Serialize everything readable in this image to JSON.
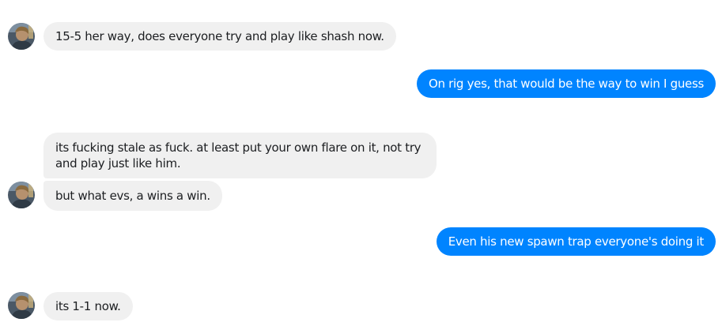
{
  "conversation": {
    "messages": [
      {
        "sender": "them",
        "text": "15-5 her way, does everyone try and play like shash now."
      },
      {
        "sender": "me",
        "text": "On rig yes, that would be the way to win I guess"
      },
      {
        "sender": "them",
        "text": "its fucking stale as fuck. at least put your own flare on it, not try and play just like him."
      },
      {
        "sender": "them",
        "text": "but what evs, a wins a win."
      },
      {
        "sender": "me",
        "text": "Even his new spawn trap everyone's doing it"
      },
      {
        "sender": "them",
        "text": "its 1-1 now."
      }
    ]
  },
  "colors": {
    "outgoing_bubble": "#0084ff",
    "incoming_bubble": "#f0f0f0",
    "incoming_text": "#1c1e21",
    "outgoing_text": "#ffffff"
  },
  "icons": {
    "avatar": "contact-avatar-photo"
  }
}
